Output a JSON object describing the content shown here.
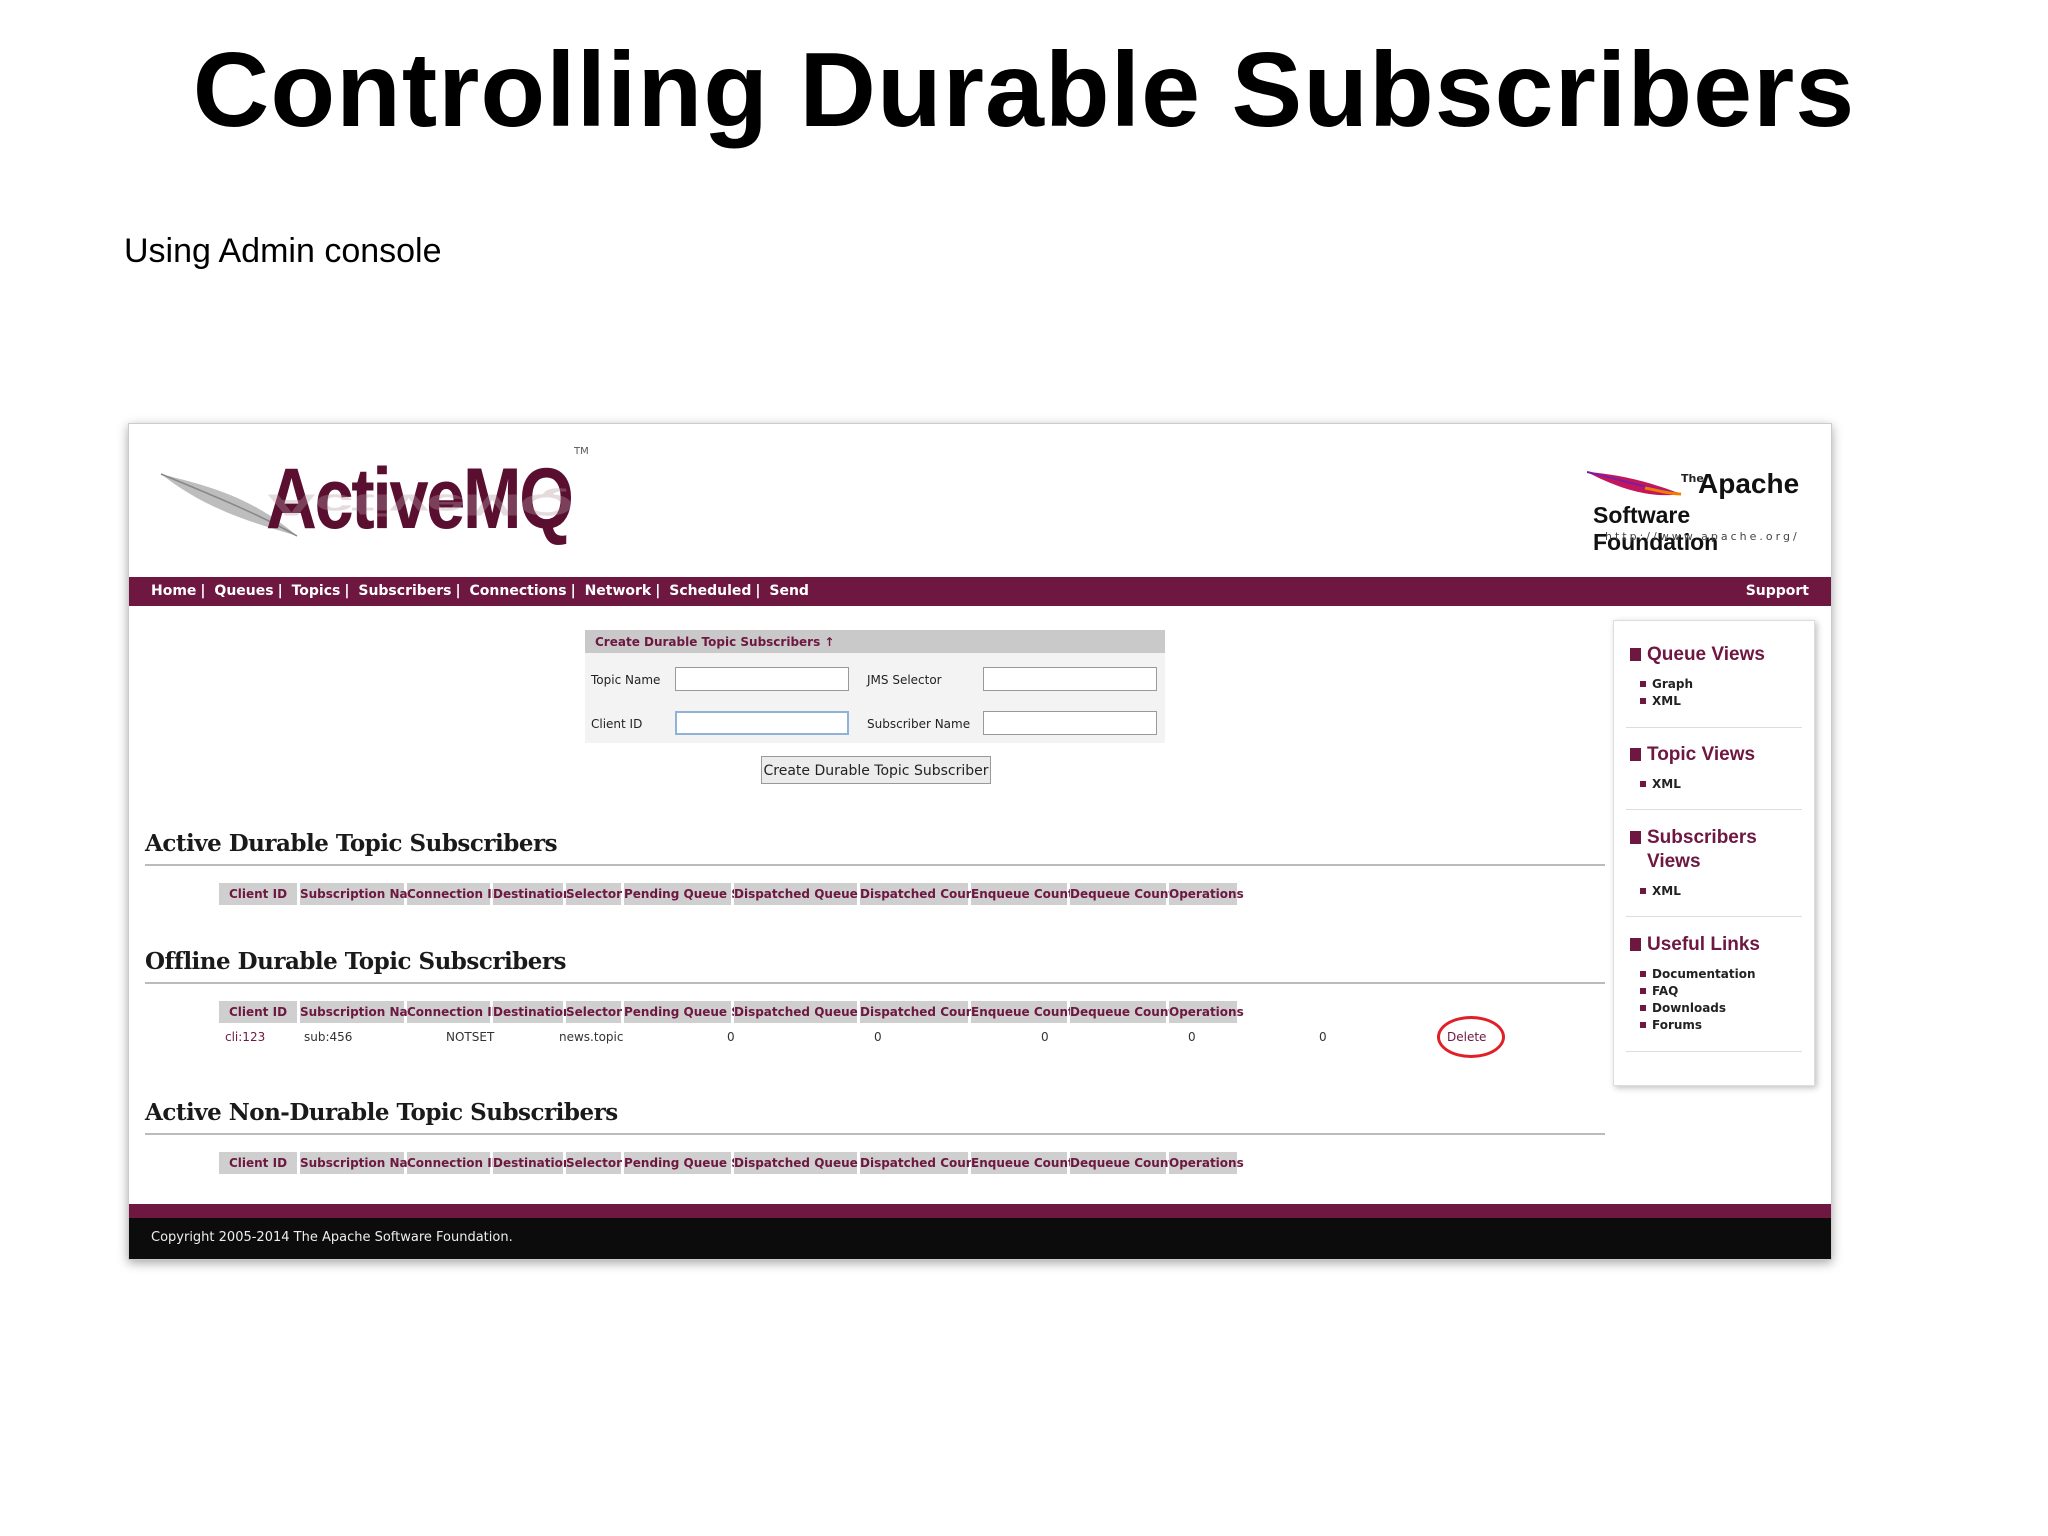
{
  "slide": {
    "title": "Controlling Durable Subscribers",
    "subtitle": "Using Admin console"
  },
  "header": {
    "logo": "ActiveMQ",
    "tm": "TM",
    "asf_the": "The",
    "asf_apache": "Apache",
    "asf_foundation": "Software Foundation",
    "asf_url": "http://www.apache.org/"
  },
  "nav": {
    "items": [
      "Home",
      "Queues",
      "Topics",
      "Subscribers",
      "Connections",
      "Network",
      "Scheduled",
      "Send"
    ],
    "support": "Support"
  },
  "form": {
    "title": "Create Durable Topic Subscribers ↑",
    "topic_name_label": "Topic Name",
    "jms_selector_label": "JMS Selector",
    "client_id_label": "Client ID",
    "subscriber_name_label": "Subscriber Name",
    "submit_label": "Create Durable Topic Subscriber"
  },
  "columns": [
    "Client ID",
    "Subscription Name",
    "Connection ID",
    "Destination",
    "Selector",
    "Pending Queue Size",
    "Dispatched Queue Size",
    "Dispatched Counter",
    "Enqueue Counter",
    "Dequeue Counter",
    "Operations"
  ],
  "sections": {
    "active_durable": "Active Durable Topic Subscribers",
    "offline_durable": "Offline Durable Topic Subscribers",
    "active_nondurable": "Active Non-Durable Topic Subscribers"
  },
  "offline_rows": [
    {
      "client_id": "cli:123",
      "subscription_name": "sub:456",
      "connection_id": "NOTSET",
      "destination": "news.topic",
      "selector": "",
      "pending_queue_size": "0",
      "dispatched_queue_size": "0",
      "dispatched_counter": "0",
      "enqueue_counter": "0",
      "dequeue_counter": "0",
      "operation": "Delete"
    }
  ],
  "sidebar": {
    "queue_views": "Queue Views",
    "queue_items": [
      "Graph",
      "XML"
    ],
    "topic_views": "Topic Views",
    "topic_items": [
      "XML"
    ],
    "subscribers_views_1": "Subscribers",
    "subscribers_views_2": "Views",
    "subscribers_items": [
      "XML"
    ],
    "useful_links": "Useful Links",
    "useful_items": [
      "Documentation",
      "FAQ",
      "Downloads",
      "Forums"
    ]
  },
  "footer": {
    "copyright": "Copyright 2005-2014 The Apache Software Foundation."
  },
  "colors": {
    "brand": "#6d1741",
    "highlight_circle": "#e01f26"
  }
}
